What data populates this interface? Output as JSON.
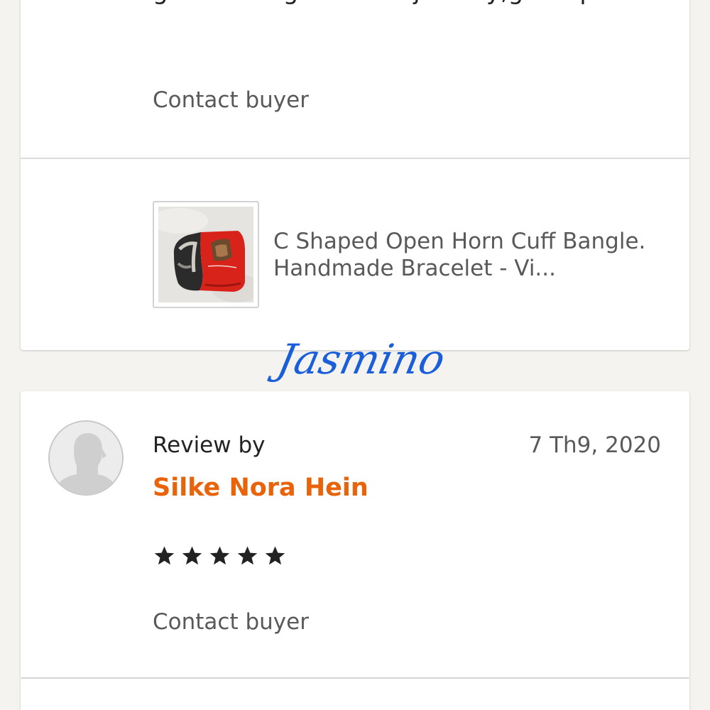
{
  "top_review": {
    "text": "great with geometric jewelry,great price.",
    "contact_label": "Contact buyer",
    "product": {
      "title": "C Shaped Open Horn Cuff Bangle. Handmade Bracelet - Vi...",
      "thumbnail_icon": "bracelet-photo"
    }
  },
  "watermark": {
    "text": "Jasmino",
    "color": "#1a5fd9"
  },
  "review": {
    "avatar_icon": "default-user-silhouette",
    "label": "Review by",
    "reviewer": "Silke Nora Hein",
    "date": "7 Th9, 2020",
    "rating": 5,
    "rating_max": 5,
    "star_icon": "star-icon",
    "contact_label": "Contact buyer"
  },
  "colors": {
    "background": "#f4f3ef",
    "card": "#ffffff",
    "reviewer_name": "#e8630a",
    "muted_text": "#595959",
    "text": "#222222"
  }
}
